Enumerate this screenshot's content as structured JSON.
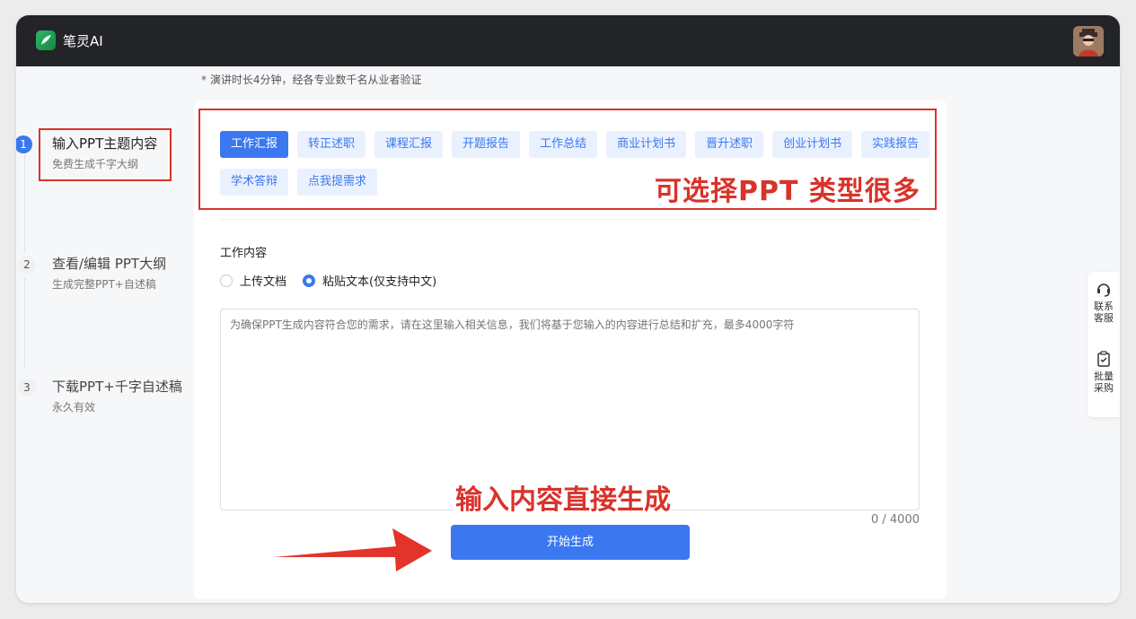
{
  "app": {
    "title": "笔灵AI"
  },
  "hint": "* 演讲时长4分钟，经各专业数千名从业者验证",
  "steps": [
    {
      "num": "1",
      "title": "输入PPT主题内容",
      "sub": "免费生成千字大纲"
    },
    {
      "num": "2",
      "title": "查看/编辑 PPT大纲",
      "sub": "生成完整PPT+自述稿"
    },
    {
      "num": "3",
      "title": "下载PPT+千字自述稿",
      "sub": "永久有效"
    }
  ],
  "types": {
    "row1": [
      "工作汇报",
      "转正述职",
      "课程汇报",
      "开题报告",
      "工作总结",
      "商业计划书",
      "晋升述职",
      "创业计划书",
      "实践报告"
    ],
    "row2": [
      "学术答辩",
      "点我提需求"
    ],
    "selected": "工作汇报"
  },
  "annotations": {
    "types": "可选择PPT 类型很多",
    "generate": "输入内容直接生成"
  },
  "content": {
    "label": "工作内容",
    "radio_upload": "上传文档",
    "radio_paste": "粘贴文本(仅支持中文)",
    "placeholder": "为确保PPT生成内容符合您的需求，请在这里输入相关信息，我们将基于您输入的内容进行总结和扩充，最多4000字符",
    "counter": "0 / 4000",
    "generate_label": "开始生成"
  },
  "float": {
    "service": "联系客服",
    "bulk": "批量采购"
  },
  "colors": {
    "accent": "#3b78f0",
    "annotation": "#d8332a",
    "topbar": "#232427"
  }
}
